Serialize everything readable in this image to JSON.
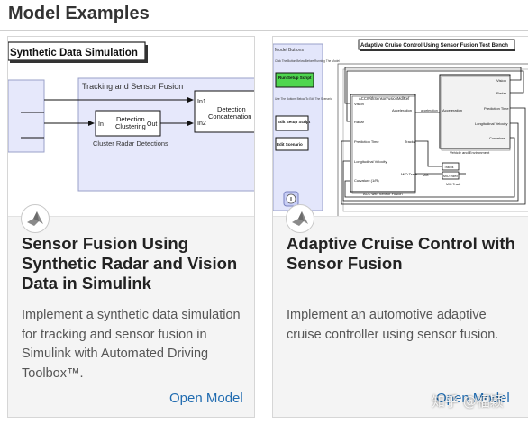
{
  "section": {
    "title": "Model Examples"
  },
  "cards": [
    {
      "title": "Sensor Fusion Using Synthetic Radar and Vision Data in Simulink",
      "description": "Implement a synthetic data simulation for tracking and sensor fusion in Simulink with Automated Driving Toolbox™.",
      "link": "Open Model",
      "thumbnail": {
        "banner": "Synthetic Data Simulation",
        "group_label": "Tracking and Sensor Fusion",
        "block1": [
          "Detection",
          "Clustering"
        ],
        "block1_in": "In",
        "block1_out": "Out",
        "block2": [
          "Detection",
          "Concatenation"
        ],
        "block2_in1": "In1",
        "block2_in2": "In2",
        "caption": "Cluster Radar Detections"
      }
    },
    {
      "title": "Adaptive Cruise Control with Sensor Fusion",
      "description": "Implement an automotive adaptive cruise controller using sensor fusion.",
      "link": "Open Model",
      "thumbnail": {
        "banner": "Adaptive Cruise Control Using Sensor Fusion Test Bench",
        "panel_title": "Model Buttons",
        "panel_note1": "Click The Button Below Before Running The Model",
        "btn1": "Run Setup Script",
        "panel_note2": "Use The Buttons Below To Edit The Scenario",
        "btn2": "Edit Setup Script",
        "btn3": "Edit Scenario",
        "acc_block_title": "ACCWithSensorFusionMdlRef",
        "acc_ports_left": [
          "Vision",
          "Radar",
          "Prediction Time",
          "Longitudinal Velocity",
          "Curvature (1/R)"
        ],
        "acc_ports_right": [
          "Acceleration",
          "Tracks",
          "MIO Track"
        ],
        "acc_caption": "ACC with Sensor Fusion",
        "veh_ports_left": [
          "Acceleration"
        ],
        "veh_ports_right": [
          "Vision",
          "Radar",
          "Prediction Time",
          "Longitudinal Velocity",
          "Curvature"
        ],
        "veh_caption": "Vehicle and Environment",
        "acceleration_label": "acceleration",
        "mio_label": "MIO",
        "tracks_label": "Tracks",
        "mio_index_label": "MIO index",
        "mio_track_label": "MIO Track"
      }
    }
  ],
  "watermark": "知乎 @福颖",
  "colors": {
    "link": "#1f6bb0",
    "title": "#222222",
    "desc": "#555555",
    "card_bg": "#f4f4f4",
    "panel_bg": "#e3e6fb"
  },
  "icons": [
    "matlab-simulink-logo-icon",
    "info-icon"
  ]
}
